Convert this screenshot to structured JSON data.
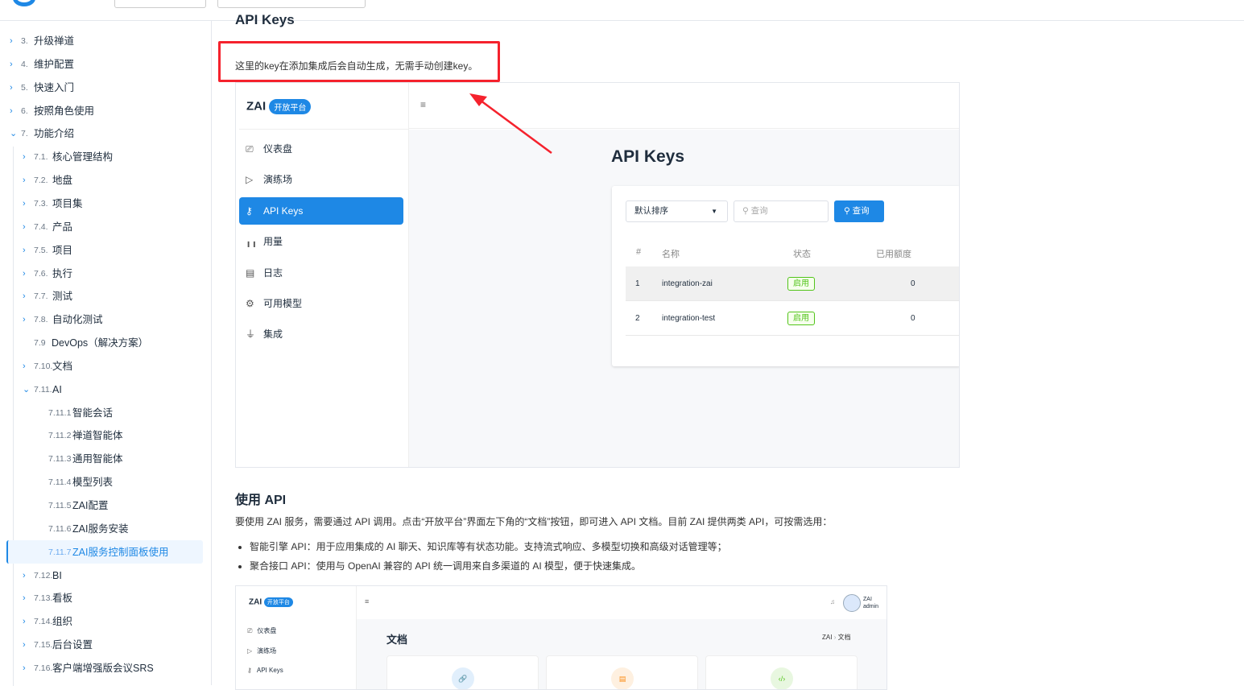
{
  "sidebar": {
    "items": [
      {
        "num": "3.",
        "label": "升级禅道",
        "level": 1,
        "arrow": "›"
      },
      {
        "num": "4.",
        "label": "维护配置",
        "level": 1,
        "arrow": "›"
      },
      {
        "num": "5.",
        "label": "快速入门",
        "level": 1,
        "arrow": "›"
      },
      {
        "num": "6.",
        "label": "按照角色使用",
        "level": 1,
        "arrow": "›"
      },
      {
        "num": "7.",
        "label": "功能介绍",
        "level": 1,
        "arrow": "⌄"
      },
      {
        "num": "7.1.",
        "label": "核心管理结构",
        "level": 2,
        "arrow": "›"
      },
      {
        "num": "7.2.",
        "label": "地盘",
        "level": 2,
        "arrow": "›"
      },
      {
        "num": "7.3.",
        "label": "项目集",
        "level": 2,
        "arrow": "›"
      },
      {
        "num": "7.4.",
        "label": "产品",
        "level": 2,
        "arrow": "›"
      },
      {
        "num": "7.5.",
        "label": "项目",
        "level": 2,
        "arrow": "›"
      },
      {
        "num": "7.6.",
        "label": "执行",
        "level": 2,
        "arrow": "›"
      },
      {
        "num": "7.7.",
        "label": "测试",
        "level": 2,
        "arrow": "›"
      },
      {
        "num": "7.8.",
        "label": "自动化测试",
        "level": 2,
        "arrow": "›"
      },
      {
        "num": "7.9",
        "label": "DevOps（解决方案）",
        "level": 2,
        "arrow": ""
      },
      {
        "num": "7.10.",
        "label": "文档",
        "level": 2,
        "arrow": "›"
      },
      {
        "num": "7.11.",
        "label": "AI",
        "level": 2,
        "arrow": "⌄"
      },
      {
        "num": "7.11.1",
        "label": "智能会话",
        "level": 3,
        "arrow": ""
      },
      {
        "num": "7.11.2",
        "label": "禅道智能体",
        "level": 3,
        "arrow": ""
      },
      {
        "num": "7.11.3",
        "label": "通用智能体",
        "level": 3,
        "arrow": ""
      },
      {
        "num": "7.11.4",
        "label": "模型列表",
        "level": 3,
        "arrow": ""
      },
      {
        "num": "7.11.5",
        "label": "ZAI配置",
        "level": 3,
        "arrow": ""
      },
      {
        "num": "7.11.6",
        "label": "ZAI服务安装",
        "level": 3,
        "arrow": ""
      },
      {
        "num": "7.11.7",
        "label": "ZAI服务控制面板使用",
        "level": 3,
        "arrow": "",
        "active": true
      },
      {
        "num": "7.12.",
        "label": "BI",
        "level": 2,
        "arrow": "›"
      },
      {
        "num": "7.13.",
        "label": "看板",
        "level": 2,
        "arrow": "›"
      },
      {
        "num": "7.14.",
        "label": "组织",
        "level": 2,
        "arrow": "›"
      },
      {
        "num": "7.15.",
        "label": "后台设置",
        "level": 2,
        "arrow": "›"
      },
      {
        "num": "7.16.",
        "label": "客户端增强版会议SRS",
        "level": 2,
        "arrow": "›"
      }
    ]
  },
  "content": {
    "section_title": "API Keys",
    "note": "这里的key在添加集成后会自动生成，无需手动创建key。",
    "section2_title": "使用 API",
    "paragraph": "要使用 ZAI 服务，需要通过 API 调用。点击“开放平台”界面左下角的“文档”按钮，即可进入 API 文档。目前 ZAI 提供两类 API，可按需选用：",
    "bullets": [
      "智能引擎 API：用于应用集成的 AI 聊天、知识库等有状态功能。支持流式响应、多模型切换和高级对话管理等；",
      "聚合接口 API：使用与 OpenAI 兼容的 API 统一调用来自多渠道的 AI 模型，便于快速集成。"
    ]
  },
  "shot1": {
    "brand": "ZAI",
    "badge": "开放平台",
    "menu_icon": "≡",
    "nav": [
      {
        "icon": "monitor-icon",
        "glyph": "⎚",
        "label": "仪表盘"
      },
      {
        "icon": "play-icon",
        "glyph": "▷",
        "label": "演练场"
      },
      {
        "icon": "key-icon",
        "glyph": "⚷",
        "label": "API Keys",
        "active": true
      },
      {
        "icon": "bar-chart-icon",
        "glyph": "╻╻",
        "label": "用量"
      },
      {
        "icon": "file-icon",
        "glyph": "▤",
        "label": "日志"
      },
      {
        "icon": "chip-icon",
        "glyph": "⚙",
        "label": "可用模型"
      },
      {
        "icon": "plug-icon",
        "glyph": "⏚",
        "label": "集成"
      }
    ],
    "title": "API Keys",
    "sort_select": "默认排序",
    "search_placeholder": "查询",
    "search_button": "查询",
    "columns": [
      "#",
      "名称",
      "状态",
      "已用额度"
    ],
    "rows": [
      {
        "no": "1",
        "name": "integration-zai",
        "status": "启用",
        "used": "0"
      },
      {
        "no": "2",
        "name": "integration-test",
        "status": "启用",
        "used": "0"
      }
    ]
  },
  "shot2": {
    "brand": "ZAI",
    "badge": "开放平台",
    "menu_icon": "≡",
    "nav": [
      {
        "glyph": "⎚",
        "label": "仪表盘"
      },
      {
        "glyph": "▷",
        "label": "演练场"
      },
      {
        "glyph": "⚷",
        "label": "API Keys"
      }
    ],
    "user_name": "ZAI",
    "user_role": "admin",
    "title": "文档",
    "breadcrumb_root": "ZAI",
    "breadcrumb_sep": "›",
    "breadcrumb_current": "文档",
    "card_colors": [
      "#1e88e5",
      "#fa8c16",
      "#52c41a"
    ]
  },
  "colors": {
    "accent": "#1e88e5",
    "highlight": "#f5222d",
    "success": "#52c41a"
  }
}
